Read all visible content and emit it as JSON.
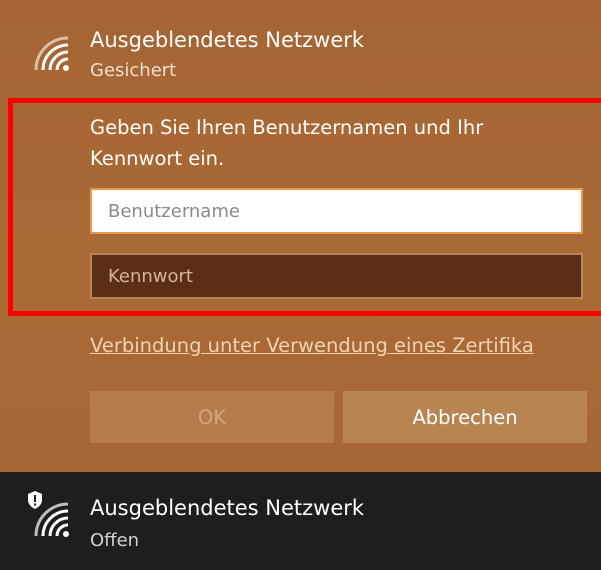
{
  "networks": [
    {
      "name": "Ausgeblendetes Netzwerk",
      "status": "Gesichert",
      "icon": "wifi-icon"
    },
    {
      "name": "Ausgeblendetes Netzwerk",
      "status": "Offen",
      "icon": "wifi-icon",
      "badge_icon": "shield-warning-icon"
    }
  ],
  "auth": {
    "prompt": "Geben Sie Ihren Benutzernamen und Ihr Kennwort ein.",
    "username_placeholder": "Benutzername",
    "password_placeholder": "Kennwort",
    "cert_link": "Verbindung unter Verwendung eines Zertifika"
  },
  "buttons": {
    "ok": "OK",
    "cancel": "Abbrechen"
  },
  "colors": {
    "panel_accent": "#a96a36",
    "highlight_border": "#ff0000",
    "bottom_background": "#1e1e1e"
  }
}
